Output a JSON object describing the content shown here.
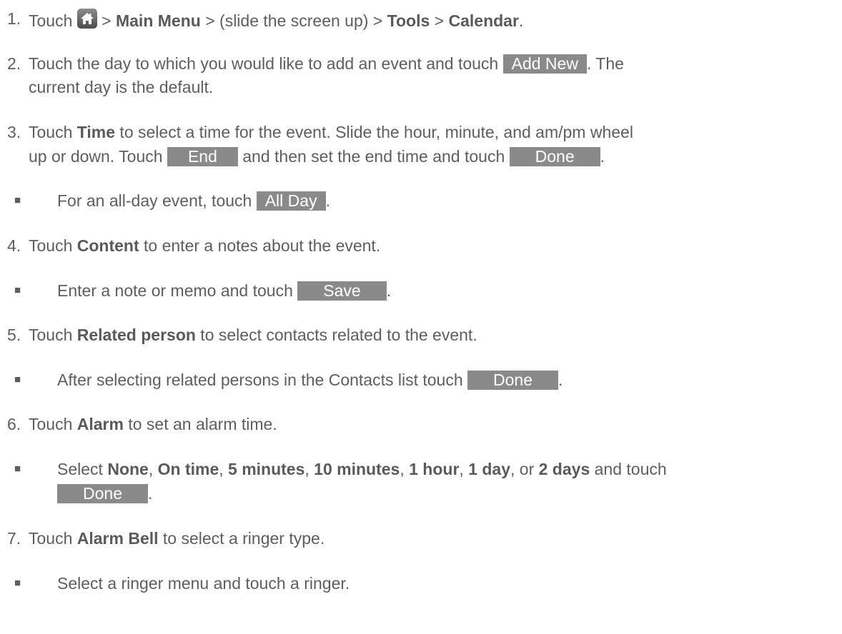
{
  "steps": [
    {
      "num": "1.",
      "parts": [
        "Touch ",
        " > ",
        "Main Menu",
        " > (slide the screen up) > ",
        "Tools",
        " > ",
        "Calendar",
        "."
      ]
    },
    {
      "num": "2.",
      "l1_pre": "Touch the day to which you would like to add an event and touch ",
      "button": "Add New",
      "l1_post": ". The",
      "l2": "current day is the default."
    },
    {
      "num": "3.",
      "l1_pre": "Touch ",
      "bold": "Time",
      "l1_post": " to select a time for the event. Slide the hour, minute, and am/pm wheel",
      "l2_pre": "up or down. Touch ",
      "button_end": "End",
      "l2_mid": " and then set the end time and touch ",
      "button_done": "Done",
      "l2_post": "."
    },
    {
      "num": "4.",
      "pre": "Touch ",
      "bold": "Content",
      "post": " to enter a notes about the event."
    },
    {
      "num": "5.",
      "pre": "Touch ",
      "bold": "Related person",
      "post": " to select contacts related to the event."
    },
    {
      "num": "6.",
      "pre": "Touch ",
      "bold": "Alarm",
      "post": " to set an alarm time."
    },
    {
      "num": "7.",
      "pre": "Touch ",
      "bold": "Alarm Bell",
      "post": " to select a ringer type."
    }
  ],
  "bullets": {
    "symbol": "■",
    "all_day": {
      "pre": "For an all-day event, touch ",
      "button": "All Day",
      "post": "."
    },
    "save": {
      "pre": "Enter a note or memo and touch ",
      "button": "Save",
      "post": "."
    },
    "contacts": {
      "pre": "After selecting related persons in the Contacts list touch ",
      "button": "Done",
      "post": "."
    },
    "alarm": {
      "pre": "Select ",
      "o1": "None",
      "c1": ", ",
      "o2": "On time",
      "c2": ", ",
      "o3": "5 minutes",
      "c3": ", ",
      "o4": "10 minutes",
      "c4": ", ",
      "o5": "1 hour",
      "c5": ", ",
      "o6": "1 day",
      "c6": ", or ",
      "o7": "2 days",
      "post": " and touch",
      "button": "Done",
      "end": "."
    },
    "ringer": {
      "text": "Select a ringer menu and touch a ringer."
    }
  },
  "icons": {
    "home": "home-icon"
  }
}
